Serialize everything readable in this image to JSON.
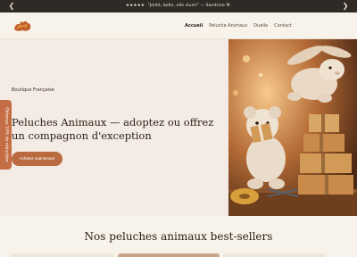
{
  "announcement": {
    "stars": "★★★★★",
    "quote": "\"Jolité, belle, elle slumi\" — Sandrine M."
  },
  "nav": {
    "items": [
      "Accueil",
      "Peluche Animaux",
      "Duelle",
      "Contact"
    ]
  },
  "hero": {
    "kicker": "Boutique Française",
    "headline": "Peluches Animaux — adoptez ou offrez un compagnon d'exception",
    "cta_label": "Acheter maintenant"
  },
  "side_tab": {
    "label": "Obtenez 10% de réduction"
  },
  "bestsellers": {
    "title": "Nos peluches animaux best-sellers"
  },
  "colors": {
    "accent": "#b96a3e",
    "announcement_bg": "#2f2a26",
    "hero_bg": "#f4ebe4",
    "page_bg": "#f8f3ea"
  }
}
